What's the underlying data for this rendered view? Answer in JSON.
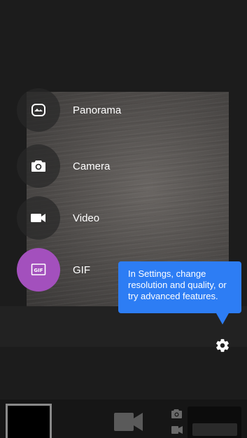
{
  "modes": [
    {
      "label": "Panorama",
      "icon": "panorama-icon",
      "active": false
    },
    {
      "label": "Camera",
      "icon": "camera-icon",
      "active": false
    },
    {
      "label": "Video",
      "icon": "video-icon",
      "active": false
    },
    {
      "label": "GIF",
      "icon": "gif-icon",
      "active": true
    }
  ],
  "tooltip": {
    "text": "In Settings, change resolution and quality, or try advanced features."
  },
  "settings": {
    "icon": "gear-icon"
  },
  "bottom_bar": {
    "thumbnail": "gallery-thumbnail",
    "primary_mode_icon": "video-camera-icon",
    "secondary_mode_icons": [
      "camera-icon",
      "video-icon"
    ]
  },
  "colors": {
    "active_mode": "#a350bd",
    "tooltip": "#2d7df4",
    "background": "#1c1c1c"
  }
}
